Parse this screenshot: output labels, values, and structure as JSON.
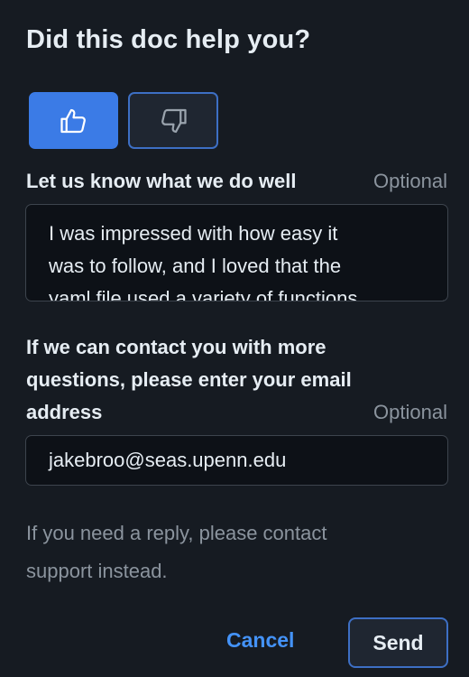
{
  "header": {
    "title": "Did this doc help you?"
  },
  "vote": {
    "selected": "thumbs-up",
    "up_icon": "thumbs-up-icon",
    "down_icon": "thumbs-down-icon",
    "up_color": "#3b7be6",
    "down_border_color": "#3d6fc4"
  },
  "feedback": {
    "label": "Let us know what we do well",
    "optional": "Optional",
    "lines": [
      "I was impressed with how easy it",
      "was to follow, and I loved that the",
      "yaml file used a variety of functions"
    ]
  },
  "contact": {
    "label_lines": [
      "If we can contact you with more",
      "questions, please enter your email",
      "address"
    ],
    "optional": "Optional",
    "email_value": "jakebroo@seas.upenn.edu"
  },
  "note_lines": [
    "If you need a reply, please contact",
    "support instead."
  ],
  "actions": {
    "cancel_label": "Cancel",
    "send_label": "Send"
  }
}
